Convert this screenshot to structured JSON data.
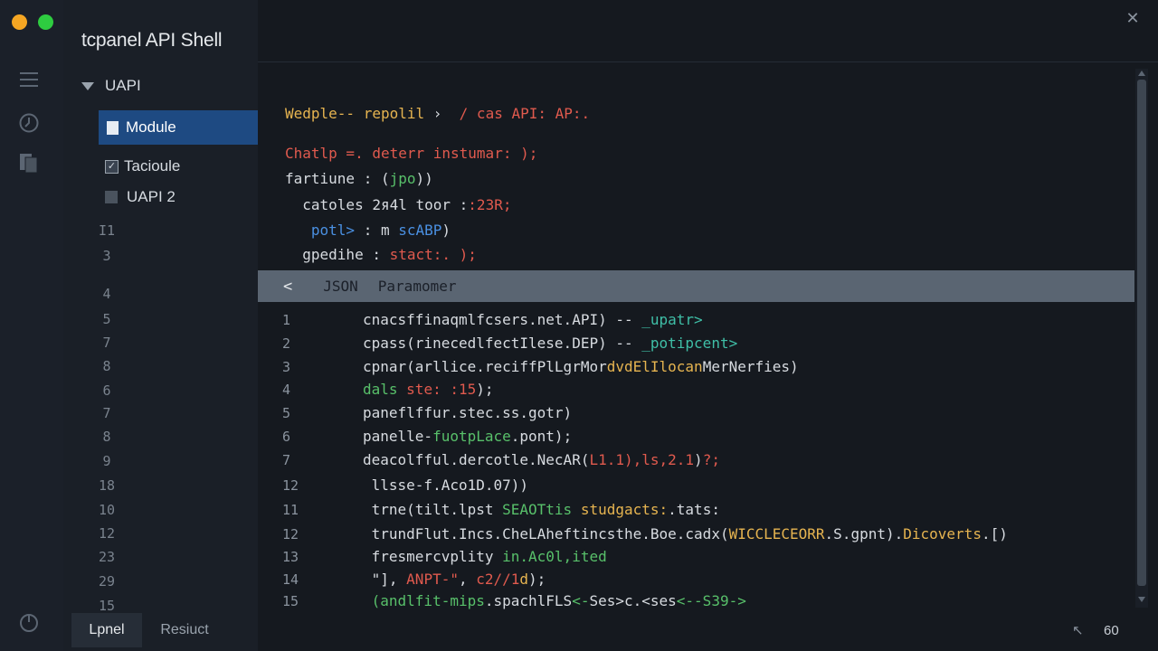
{
  "app": {
    "title": "tcpanel API Shell"
  },
  "window": {
    "close_glyph": "✕"
  },
  "tree": {
    "root_label": "UAPI",
    "items": [
      {
        "label": "Module",
        "icon": "file-icon",
        "selected": true
      },
      {
        "label": "Tacioule",
        "icon": "checkbox-icon"
      },
      {
        "label": "UAPI 2",
        "icon": "folder-icon"
      }
    ]
  },
  "gutter": [
    "I1",
    "3",
    "4",
    "5",
    "7",
    "8",
    "6",
    "7",
    "8",
    "9",
    "18",
    "10",
    "12",
    "23",
    "29",
    "15"
  ],
  "bottom_tabs": [
    {
      "label": "Lpnel",
      "active": true
    },
    {
      "label": "Resiuct",
      "active": false
    }
  ],
  "editor": {
    "top_lines": [
      {
        "segments": [
          {
            "t": "Wedple-- repolil",
            "c": "y"
          },
          {
            "t": " › ",
            "c": "w"
          },
          {
            "t": " / cas API: AP:.",
            "c": "r"
          }
        ]
      },
      {
        "segments": [
          {
            "t": "Chatlp =. ",
            "c": "r"
          },
          {
            "t": "deterr instumar: );",
            "c": "r"
          }
        ]
      },
      {
        "segments": [
          {
            "t": "fartiune : (",
            "c": "w"
          },
          {
            "t": "jpo",
            "c": "g"
          },
          {
            "t": "))",
            "c": "w"
          }
        ]
      },
      {
        "segments": [
          {
            "t": "  catoles 2я4l toor :",
            "c": "w"
          },
          {
            "t": ":23R;",
            "c": "r"
          }
        ]
      },
      {
        "segments": [
          {
            "t": "   potl>",
            "c": "b"
          },
          {
            "t": " : m ",
            "c": "w"
          },
          {
            "t": "scABP",
            "c": "b"
          },
          {
            "t": ")",
            "c": "w"
          }
        ]
      },
      {
        "segments": [
          {
            "t": "  gpedihe : ",
            "c": "w"
          },
          {
            "t": "stact:. );",
            "c": "r"
          }
        ]
      }
    ],
    "panel": {
      "back_glyph": "<",
      "label_a": "JSON",
      "label_b": "Paramomer"
    },
    "lines": [
      {
        "n": "1",
        "segments": [
          {
            "t": "cnacsffinaqmlfcsers.net.API) -- ",
            "c": "w"
          },
          {
            "t": "_upatr>",
            "c": "t"
          }
        ]
      },
      {
        "n": "2",
        "segments": [
          {
            "t": "cpass(rinecedlfectIlese.DEP) -- ",
            "c": "w"
          },
          {
            "t": "_potipcent>",
            "c": "t"
          }
        ]
      },
      {
        "n": "3",
        "segments": [
          {
            "t": "cpnar(arllice.reciffPlLgrMor",
            "c": "w"
          },
          {
            "t": "dvdElIlocan",
            "c": "y"
          },
          {
            "t": "MerNerfies)",
            "c": "w"
          }
        ]
      },
      {
        "n": "4",
        "segments": [
          {
            "t": "dals ",
            "c": "g"
          },
          {
            "t": "ste: :15",
            "c": "r"
          },
          {
            "t": ");",
            "c": "w"
          }
        ]
      },
      {
        "n": "5",
        "segments": [
          {
            "t": "paneflffur.stec.ss.gotr)",
            "c": "w"
          }
        ]
      },
      {
        "n": "6",
        "segments": [
          {
            "t": "panelle-",
            "c": "w"
          },
          {
            "t": "fuotpLace",
            "c": "g"
          },
          {
            "t": ".pont);",
            "c": "w"
          }
        ]
      },
      {
        "n": "7",
        "segments": [
          {
            "t": "deacolfful.dercotle.NecAR(",
            "c": "w"
          },
          {
            "t": "L1.1),ls,2.1",
            "c": "r"
          },
          {
            "t": ")",
            "c": "w"
          },
          {
            "t": "?;",
            "c": "r"
          }
        ]
      },
      {
        "n": "12",
        "segments": [
          {
            "t": " llsse-f.Aco1D.07))",
            "c": "w"
          }
        ]
      },
      {
        "n": "11",
        "segments": [
          {
            "t": " trne(tilt.lpst ",
            "c": "w"
          },
          {
            "t": "SEAOTtis ",
            "c": "g"
          },
          {
            "t": "studgacts:",
            "c": "y"
          },
          {
            "t": ".tats:",
            "c": "w"
          }
        ]
      },
      {
        "n": "12",
        "segments": [
          {
            "t": " trundFlut.Incs.CheLAheftincsthe.Boe.cadх(",
            "c": "w"
          },
          {
            "t": "WICCLECEORR",
            "c": "y"
          },
          {
            "t": ".S.gpnt).",
            "c": "w"
          },
          {
            "t": "Dicoverts",
            "c": "y"
          },
          {
            "t": ".[)",
            "c": "w"
          }
        ]
      },
      {
        "n": "13",
        "segments": [
          {
            "t": " fresmercvplity ",
            "c": "w"
          },
          {
            "t": "in.Ac0l,ited",
            "c": "g"
          }
        ]
      },
      {
        "n": "14",
        "segments": [
          {
            "t": " \"], ",
            "c": "w"
          },
          {
            "t": "ANPT-\"",
            "c": "r"
          },
          {
            "t": ", ",
            "c": "w"
          },
          {
            "t": "c2//1",
            "c": "r"
          },
          {
            "t": "d",
            "c": "y"
          },
          {
            "t": ");",
            "c": "w"
          }
        ]
      },
      {
        "n": "15",
        "segments": [
          {
            "t": " (andlfit-mips",
            "c": "g"
          },
          {
            "t": ".spachlFLS",
            "c": "w"
          },
          {
            "t": "<-",
            "c": "g"
          },
          {
            "t": "Ses>c.<ses",
            "c": "w"
          },
          {
            "t": "<--S39->",
            "c": "g"
          }
        ]
      }
    ]
  },
  "status": {
    "cursor_glyph": "↖",
    "value": "60"
  },
  "colors": {
    "selected_bg": "#1e4a82",
    "panel_bar": "#5a6572",
    "dot_orange": "#f5a623",
    "dot_green": "#2ecc40"
  }
}
